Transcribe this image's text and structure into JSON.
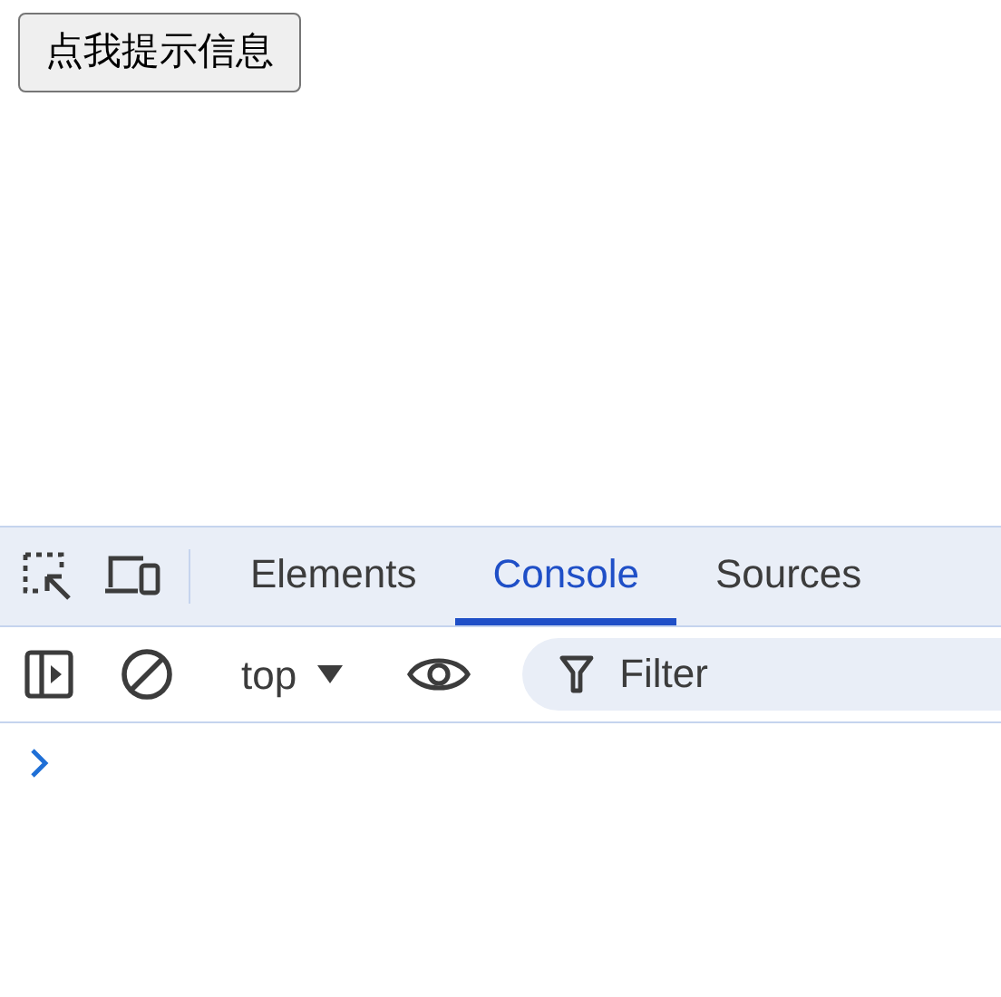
{
  "page_button": {
    "label": "点我提示信息"
  },
  "devtools": {
    "tabs": [
      {
        "label": "Elements",
        "selected": false
      },
      {
        "label": "Console",
        "selected": true
      },
      {
        "label": "Sources",
        "selected": false
      }
    ],
    "context": {
      "label": "top"
    },
    "filter": {
      "placeholder": "Filter"
    }
  }
}
